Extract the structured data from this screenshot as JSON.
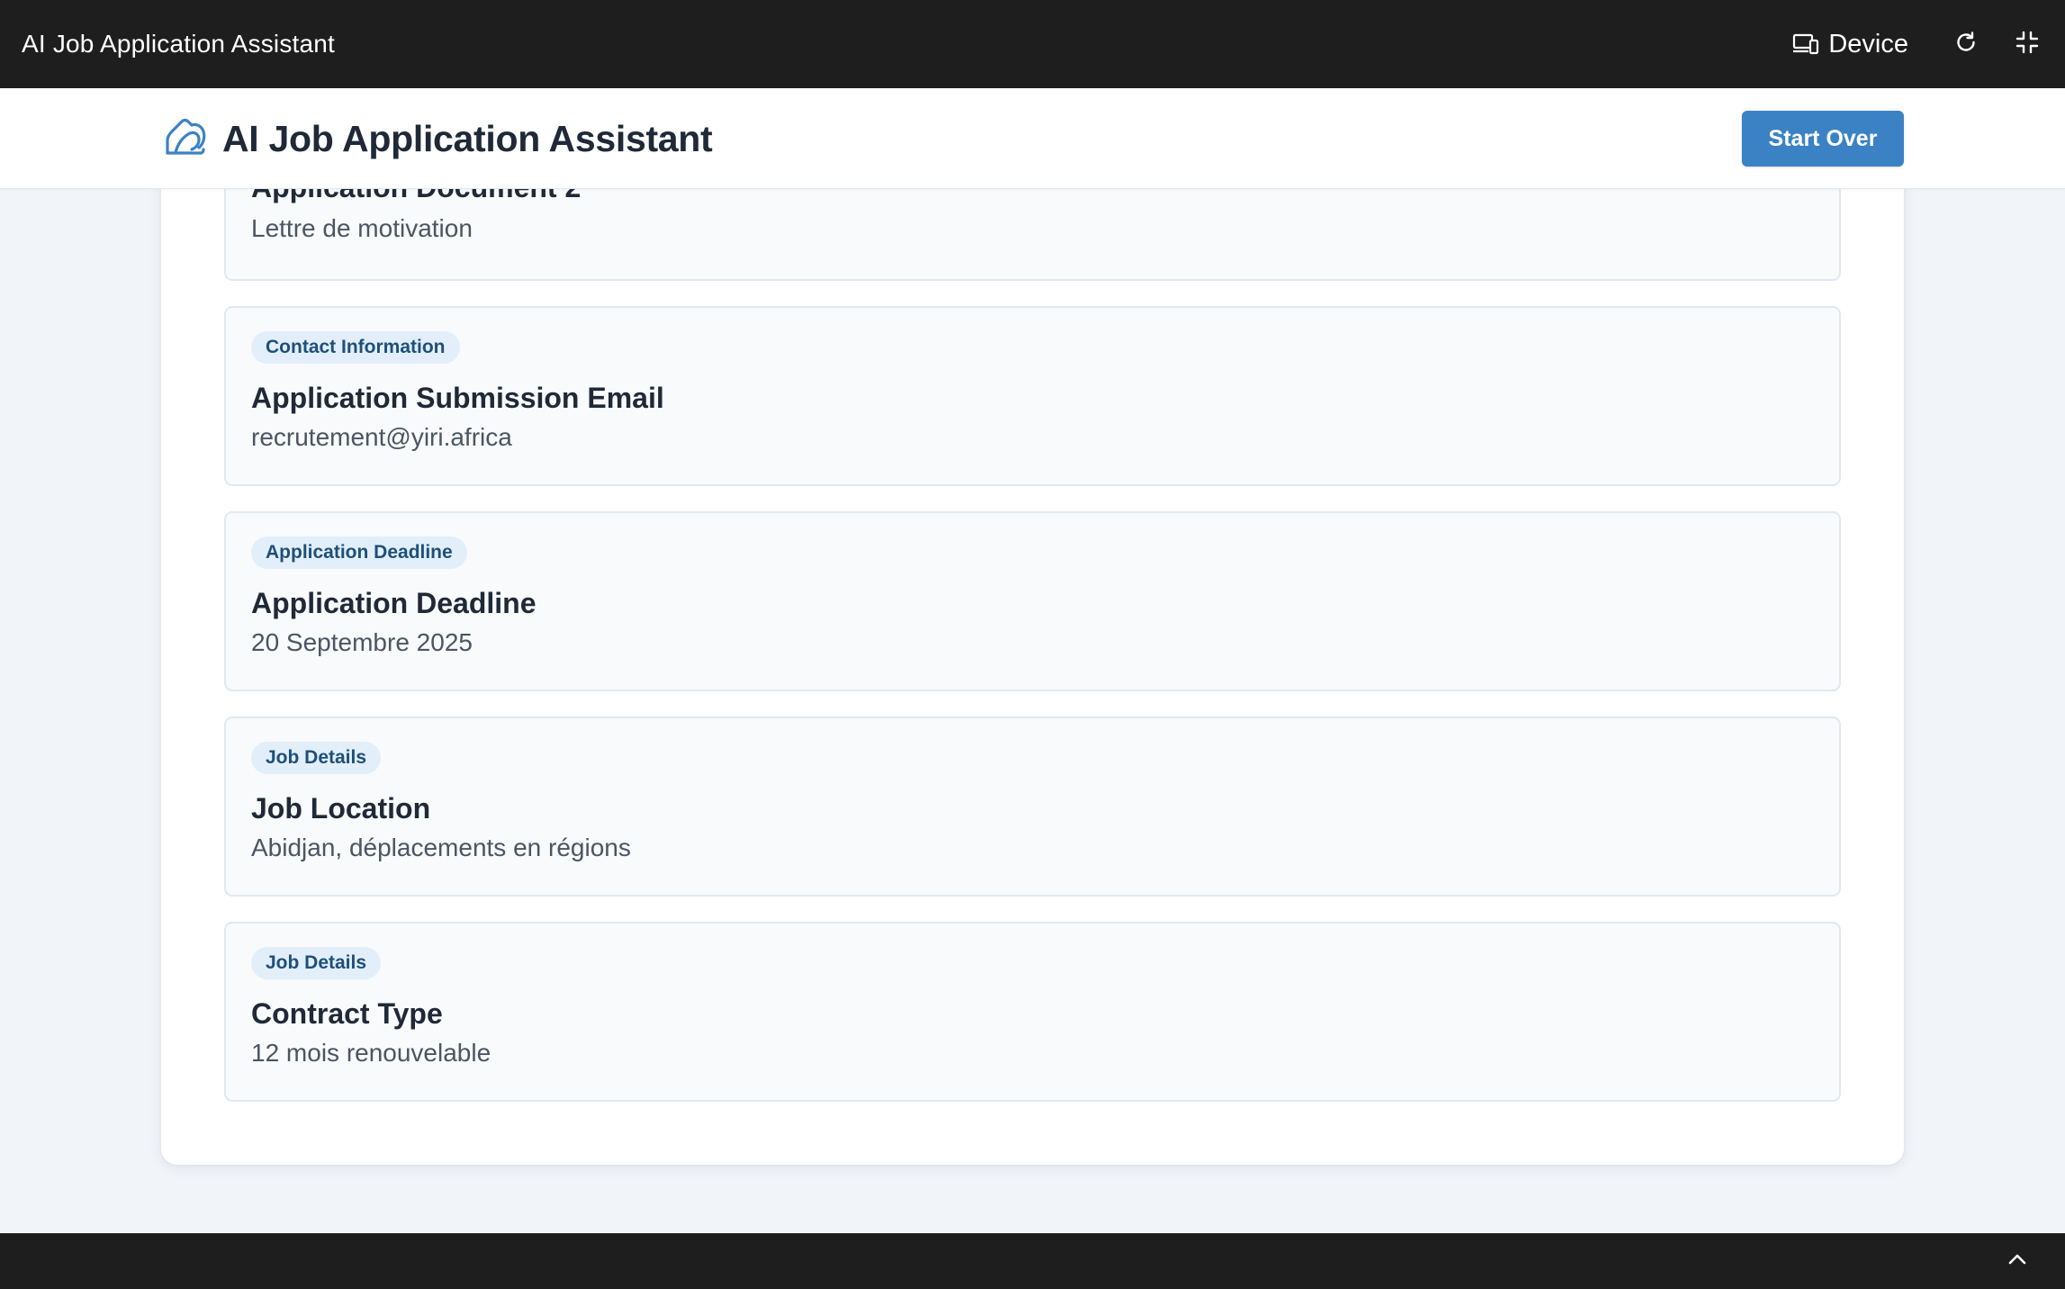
{
  "window": {
    "title": "AI Job Application Assistant",
    "device_label": "Device",
    "icons": {
      "device": "device-icon",
      "refresh": "refresh-icon",
      "exit_fullscreen": "exit-fullscreen-icon",
      "scroll_up": "chevron-up-icon"
    }
  },
  "header": {
    "logo_icon": "mountain-logo-icon",
    "title": "AI Job Application Assistant",
    "start_over_label": "Start Over"
  },
  "colors": {
    "accent": "#3b82c4",
    "badge_bg": "#e2effa",
    "badge_text": "#1e4f7a",
    "chrome_bg": "#1e1e1e"
  },
  "items": [
    {
      "badge": "",
      "title": "Application Document 2",
      "value": "Lettre de motivation"
    },
    {
      "badge": "Contact Information",
      "title": "Application Submission Email",
      "value": "recrutement@yiri.africa"
    },
    {
      "badge": "Application Deadline",
      "title": "Application Deadline",
      "value": "20 Septembre 2025"
    },
    {
      "badge": "Job Details",
      "title": "Job Location",
      "value": "Abidjan, déplacements en régions"
    },
    {
      "badge": "Job Details",
      "title": "Contract Type",
      "value": "12 mois renouvelable"
    }
  ]
}
